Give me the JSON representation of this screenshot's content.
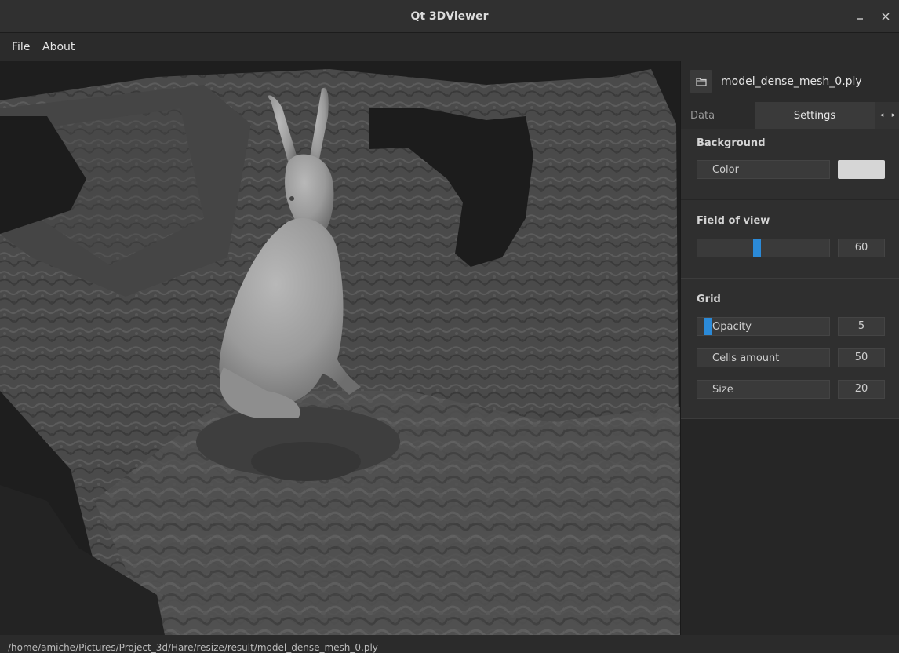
{
  "window": {
    "title": "Qt 3DViewer",
    "minimize_icon": "minimize-icon",
    "close_icon": "close-icon"
  },
  "menu": {
    "file": "File",
    "about": "About"
  },
  "panel": {
    "filename": "model_dense_mesh_0.ply",
    "folder_icon": "folder-icon",
    "tabs": {
      "data": "Data",
      "settings": "Settings"
    },
    "background": {
      "title": "Background",
      "color_label": "Color",
      "color_value": "#d6d6d6"
    },
    "field_of_view": {
      "title": "Field of view",
      "value": "60",
      "slider_fraction": 0.45
    },
    "grid": {
      "title": "Grid",
      "opacity_label": "Opacity",
      "opacity_value": "5",
      "opacity_fraction": 0.05,
      "cells_label": "Cells amount",
      "cells_value": "50",
      "size_label": "Size",
      "size_value": "20"
    }
  },
  "status": {
    "path": "/home/amiche/Pictures/Project_3d/Hare/resize/result/model_dense_mesh_0.ply"
  },
  "colors": {
    "accent": "#2b8ad8",
    "background": "#262626"
  }
}
